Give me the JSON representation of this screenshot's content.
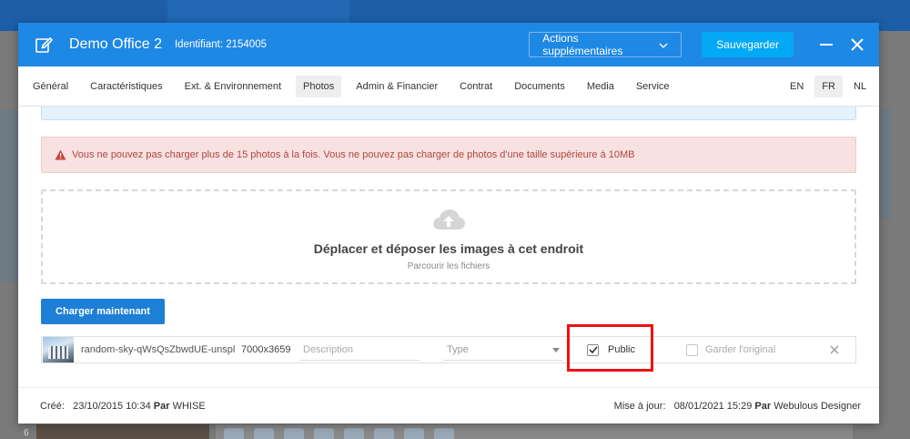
{
  "modal": {
    "title": "Demo Office 2",
    "identifier": "Identifiant: 2154005",
    "actions_label": "Actions supplémentaires",
    "save_label": "Sauvegarder"
  },
  "tabs": [
    {
      "label": "Général"
    },
    {
      "label": "Caractéristiques"
    },
    {
      "label": "Ext. & Environnement"
    },
    {
      "label": "Photos",
      "active": true
    },
    {
      "label": "Admin & Financier"
    },
    {
      "label": "Contrat"
    },
    {
      "label": "Documents"
    },
    {
      "label": "Media"
    },
    {
      "label": "Service"
    }
  ],
  "languages": [
    {
      "label": "EN"
    },
    {
      "label": "FR",
      "active": true
    },
    {
      "label": "NL"
    }
  ],
  "alert": {
    "text": "Vous ne pouvez pas charger plus de 15 photos à la fois. Vous ne pouvez pas charger de photos d'une taille supérieure à 10MB"
  },
  "dropzone": {
    "title": "Déplacer et déposer les images à cet endroit",
    "browse": "Parcourir les fichiers"
  },
  "upload_button": "Charger maintenant",
  "file": {
    "name": "random-sky-qWsQsZbwdUE-unspl...",
    "dimensions": "7000x3659",
    "description_placeholder": "Description",
    "type_placeholder": "Type",
    "public_label": "Public",
    "public_checked": true,
    "keep_original_label": "Garder l'original",
    "keep_original_checked": false
  },
  "footer": {
    "created_label": "Créé:",
    "created_date": "23/10/2015 10:34",
    "by_label": "Par",
    "created_by": "WHISE",
    "updated_label": "Mise à jour:",
    "updated_date": "08/01/2021 15:29",
    "updated_by": "Webulous Designer"
  },
  "background": {
    "count_label": "6"
  },
  "colors": {
    "header": "#1e88e5",
    "save": "#03a9f4",
    "upload": "#1e7fd6",
    "alert_bg": "#f7e1e1",
    "alert_text": "#b0473f",
    "highlight": "#ee1111"
  }
}
